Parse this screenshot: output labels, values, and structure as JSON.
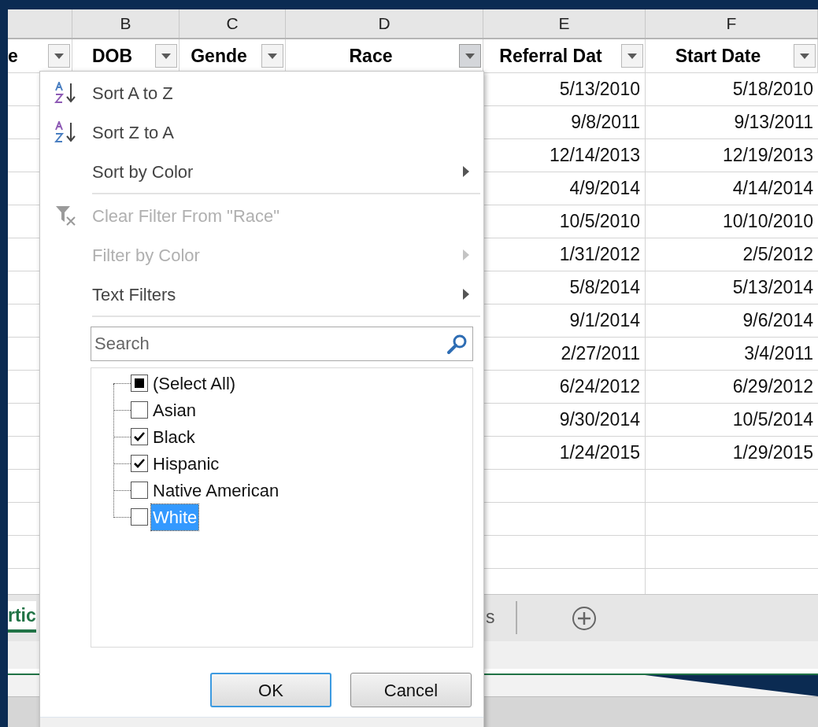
{
  "column_letters": [
    "B",
    "C",
    "D",
    "E",
    "F"
  ],
  "header_cells": [
    {
      "text": "e",
      "filter_open": false
    },
    {
      "text": "DOB",
      "filter_open": false
    },
    {
      "text": "Gende",
      "filter_open": false
    },
    {
      "text": "Race",
      "filter_open": true
    },
    {
      "text": "Referral Dat",
      "filter_open": false
    },
    {
      "text": "Start Date",
      "filter_open": false
    }
  ],
  "rows": [
    {
      "referral_date": "5/13/2010",
      "start_date": "5/18/2010"
    },
    {
      "referral_date": "9/8/2011",
      "start_date": "9/13/2011"
    },
    {
      "referral_date": "12/14/2013",
      "start_date": "12/19/2013"
    },
    {
      "referral_date": "4/9/2014",
      "start_date": "4/14/2014"
    },
    {
      "referral_date": "10/5/2010",
      "start_date": "10/10/2010"
    },
    {
      "referral_date": "1/31/2012",
      "start_date": "2/5/2012"
    },
    {
      "referral_date": "5/8/2014",
      "start_date": "5/13/2014"
    },
    {
      "referral_date": "9/1/2014",
      "start_date": "9/6/2014"
    },
    {
      "referral_date": "2/27/2011",
      "start_date": "3/4/2011"
    },
    {
      "referral_date": "6/24/2012",
      "start_date": "6/29/2012"
    },
    {
      "referral_date": "9/30/2014",
      "start_date": "10/5/2014"
    },
    {
      "referral_date": "1/24/2015",
      "start_date": "1/29/2015"
    }
  ],
  "sheet_tabs": [
    {
      "label": "rtic",
      "selected": true
    },
    {
      "label": "s",
      "selected": false
    }
  ],
  "filter_menu": {
    "items": [
      {
        "kind": "sort_asc",
        "label": "Sort A to Z",
        "disabled": false,
        "submenu": false
      },
      {
        "kind": "sort_desc",
        "label": "Sort Z to A",
        "disabled": false,
        "submenu": false
      },
      {
        "kind": "plain",
        "label": "Sort by Color",
        "disabled": false,
        "submenu": true
      },
      {
        "kind": "separator"
      },
      {
        "kind": "clear_filter",
        "label": "Clear Filter From \"Race\"",
        "disabled": true,
        "submenu": false
      },
      {
        "kind": "plain",
        "label": "Filter by Color",
        "disabled": true,
        "submenu": true
      },
      {
        "kind": "plain",
        "label": "Text Filters",
        "disabled": false,
        "submenu": true
      },
      {
        "kind": "separator"
      }
    ],
    "search": {
      "placeholder": "Search"
    },
    "values": [
      {
        "label": "(Select All)",
        "checked": false,
        "indeterminate": true,
        "selected": false
      },
      {
        "label": "Asian",
        "checked": false,
        "indeterminate": false,
        "selected": false
      },
      {
        "label": "Black",
        "checked": true,
        "indeterminate": false,
        "selected": false
      },
      {
        "label": "Hispanic",
        "checked": true,
        "indeterminate": false,
        "selected": false
      },
      {
        "label": "Native American",
        "checked": false,
        "indeterminate": false,
        "selected": false
      },
      {
        "label": "White",
        "checked": false,
        "indeterminate": false,
        "selected": true
      }
    ],
    "buttons": [
      {
        "label": "OK",
        "default": true
      },
      {
        "label": "Cancel",
        "default": false
      }
    ]
  }
}
